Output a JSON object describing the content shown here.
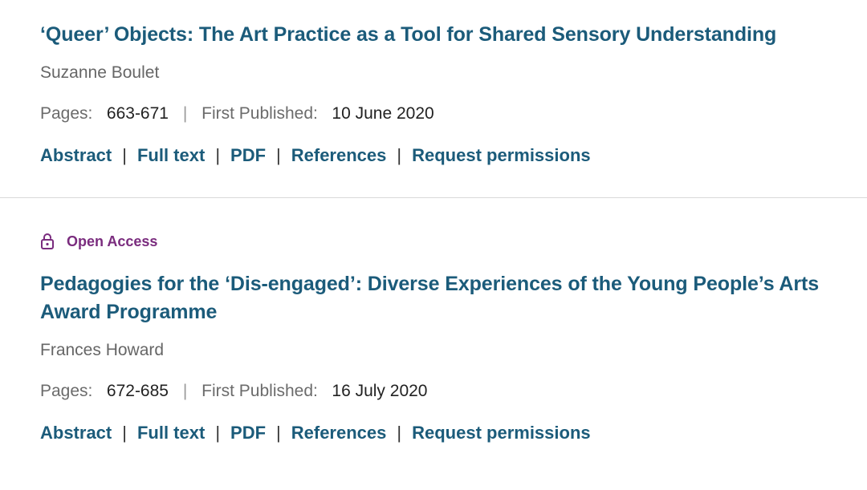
{
  "articles": [
    {
      "title": "‘Queer’ Objects: The Art Practice as a Tool for Shared Sensory Understanding",
      "author": "Suzanne Boulet",
      "pages_label": "Pages:",
      "pages": "663-671",
      "published_label": "First Published:",
      "published": "10 June 2020",
      "links": {
        "abstract": "Abstract",
        "full_text": "Full text",
        "pdf": "PDF",
        "references": "References",
        "request_permissions": "Request permissions"
      }
    },
    {
      "open_access": "Open Access",
      "title": "Pedagogies for the ‘Dis-engaged’: Diverse Experiences of the Young People’s Arts Award Programme",
      "author": "Frances Howard",
      "pages_label": "Pages:",
      "pages": "672-685",
      "published_label": "First Published:",
      "published": "16 July 2020",
      "links": {
        "abstract": "Abstract",
        "full_text": "Full text",
        "pdf": "PDF",
        "references": "References",
        "request_permissions": "Request permissions"
      }
    }
  ],
  "separator": "|",
  "icons": {
    "open_access": "unlocked-padlock-icon"
  },
  "colors": {
    "title": "#1b5b7a",
    "open_access": "#7a2c7e",
    "author": "#666666",
    "divider": "#d9d9d9"
  }
}
